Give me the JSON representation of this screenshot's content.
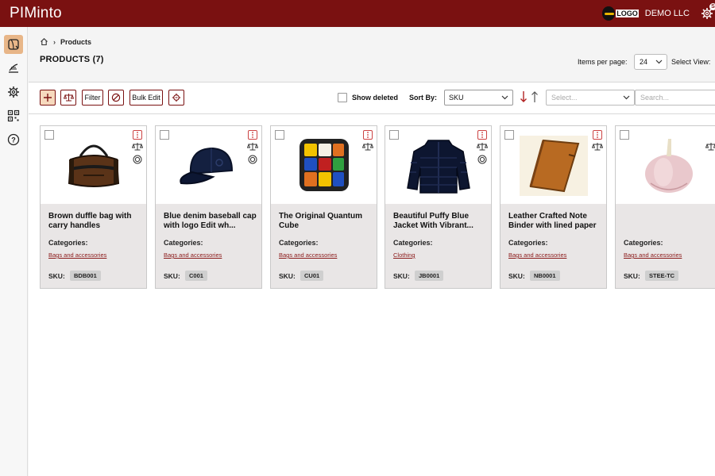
{
  "app": {
    "title": "PIMinto",
    "company": "DEMO LLC",
    "logo_text": "LOGO"
  },
  "sidebar": {
    "items": [
      {
        "name": "products"
      },
      {
        "name": "import"
      },
      {
        "name": "settings"
      },
      {
        "name": "assets"
      },
      {
        "name": "help"
      }
    ]
  },
  "breadcrumb": {
    "current": "Products"
  },
  "page": {
    "title": "PRODUCTS (7)"
  },
  "pagination": {
    "items_per_page_label": "Items per page:",
    "items_per_page_value": "24",
    "select_view_label": "Select View:"
  },
  "toolbar": {
    "filter_label": "Filter",
    "bulk_edit_label": "Bulk Edit",
    "show_deleted_label": "Show deleted",
    "sort_by_label": "Sort By:",
    "sort_by_value": "SKU",
    "filter_select_placeholder": "Select...",
    "search_placeholder": "Search..."
  },
  "products": [
    {
      "name": "Brown duffle bag with carry handles",
      "categories_label": "Categories:",
      "category": "Bags and accessories",
      "sku_label": "SKU:",
      "sku": "BDB001",
      "icon": "duffle-bag"
    },
    {
      "name": "Blue denim baseball cap with logo Edit wh...",
      "categories_label": "Categories:",
      "category": "Bags and accessories",
      "sku_label": "SKU:",
      "sku": "C001",
      "icon": "baseball-cap"
    },
    {
      "name": "The Original Quantum Cube",
      "categories_label": "Categories:",
      "category": "Bags and accessories",
      "sku_label": "SKU:",
      "sku": "CU01",
      "icon": "puzzle-cube"
    },
    {
      "name": "Beautiful Puffy Blue Jacket With Vibrant...",
      "categories_label": "Categories:",
      "category": "Clothing",
      "sku_label": "SKU:",
      "sku": "JB0001",
      "icon": "puffer-jacket"
    },
    {
      "name": "Leather Crafted Note Binder with lined paper",
      "categories_label": "Categories:",
      "category": "Bags and accessories",
      "sku_label": "SKU:",
      "sku": "NB0001",
      "icon": "notebook"
    },
    {
      "name": "",
      "categories_label": "Categories:",
      "category": "Bags and accessories",
      "sku_label": "SKU:",
      "sku": "STEE-TC",
      "icon": "garlic"
    }
  ],
  "colors": {
    "brand": "#7a1111",
    "accent": "#e8b688",
    "link": "#8b1a1a"
  }
}
